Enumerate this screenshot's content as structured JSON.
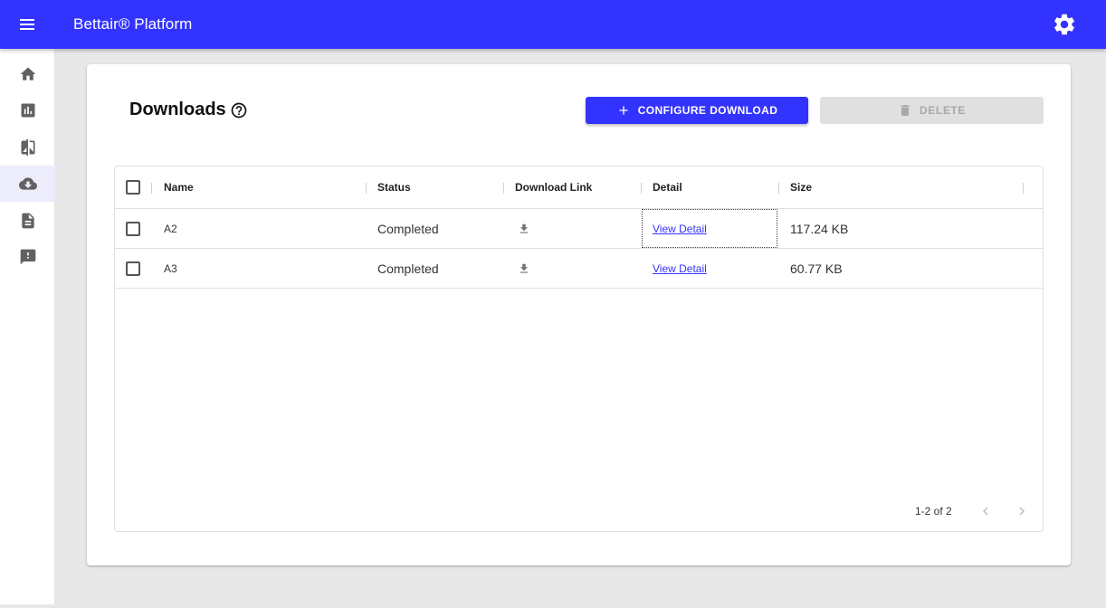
{
  "appbar": {
    "title": "Bettair® Platform",
    "menu_icon": "hamburger-menu-icon",
    "settings_icon": "gear-icon",
    "color": "#3333ff"
  },
  "sidebar": {
    "items": [
      {
        "name": "home",
        "icon": "home-icon",
        "active": false
      },
      {
        "name": "charts",
        "icon": "bar-chart-icon",
        "active": false
      },
      {
        "name": "compare",
        "icon": "compare-icon",
        "active": false
      },
      {
        "name": "downloads",
        "icon": "cloud-download-icon",
        "active": true
      },
      {
        "name": "reports",
        "icon": "document-icon",
        "active": false
      },
      {
        "name": "alerts",
        "icon": "feedback-alert-icon",
        "active": false
      }
    ]
  },
  "page": {
    "title": "Downloads",
    "help_icon": "help-circle-icon",
    "configure_button": "CONFIGURE DOWNLOAD",
    "delete_button": "DELETE"
  },
  "table": {
    "columns": [
      "Name",
      "Status",
      "Download Link",
      "Detail",
      "Size"
    ],
    "rows": [
      {
        "name": "A2",
        "status": "Completed",
        "download_icon": "download-icon",
        "detail": "View Detail",
        "size": "117.24 KB"
      },
      {
        "name": "A3",
        "status": "Completed",
        "download_icon": "download-icon",
        "detail": "View Detail",
        "size": "60.77 KB"
      }
    ],
    "pagination": {
      "text": "1-2 of 2",
      "prev_icon": "chevron-left-icon",
      "next_icon": "chevron-right-icon"
    }
  }
}
